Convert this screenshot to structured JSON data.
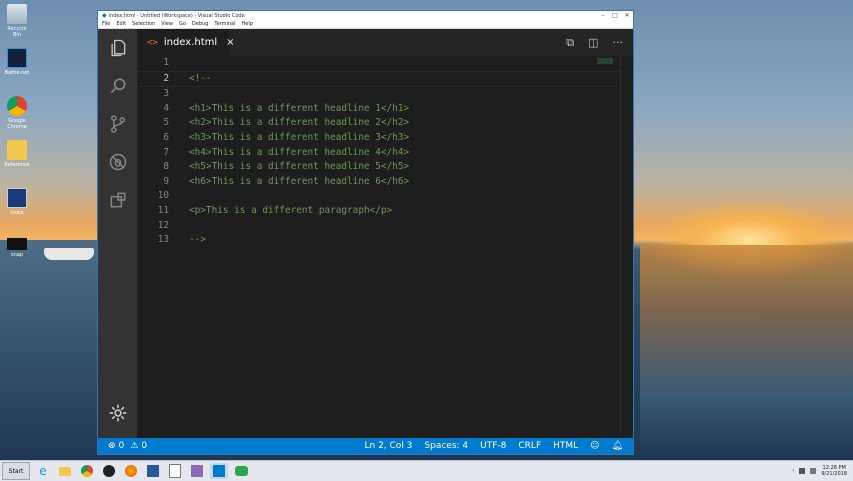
{
  "desktop": {
    "icons": [
      {
        "label": "Recycle Bin",
        "icon": "recycle-bin-icon"
      },
      {
        "label": "Battle.net",
        "icon": "battlenet-icon"
      },
      {
        "label": "Google Chrome",
        "icon": "chrome-icon"
      },
      {
        "label": "Reference",
        "icon": "folder-icon"
      },
      {
        "label": "index",
        "icon": "file-icon"
      },
      {
        "label": "snap",
        "icon": "monitor-icon"
      }
    ]
  },
  "window": {
    "title": "index.html - Untitled (Workspace) - Visual Studio Code",
    "menu": [
      "File",
      "Edit",
      "Selection",
      "View",
      "Go",
      "Debug",
      "Terminal",
      "Help"
    ]
  },
  "tab": {
    "label": "index.html",
    "close": "×"
  },
  "editor": {
    "lines": [
      {
        "num": "1",
        "text": ""
      },
      {
        "num": "2",
        "text": "<!--"
      },
      {
        "num": "3",
        "text": ""
      },
      {
        "num": "4",
        "text": "<h1>This is a different headline 1</h1>"
      },
      {
        "num": "5",
        "text": "<h2>This is a different headline 2</h2>"
      },
      {
        "num": "6",
        "text": "<h3>This is a different headline 3</h3>"
      },
      {
        "num": "7",
        "text": "<h4>This is a different headline 4</h4>"
      },
      {
        "num": "8",
        "text": "<h5>This is a different headline 5</h5>"
      },
      {
        "num": "9",
        "text": "<h6>This is a different headline 6</h6>"
      },
      {
        "num": "10",
        "text": ""
      },
      {
        "num": "11",
        "text": "<p>This is a different paragraph</p>"
      },
      {
        "num": "12",
        "text": ""
      },
      {
        "num": "13",
        "text": "-->"
      }
    ]
  },
  "status": {
    "errors": "0",
    "warnings": "0",
    "position": "Ln 2, Col 3",
    "spaces": "Spaces: 4",
    "encoding": "UTF-8",
    "eol": "CRLF",
    "language": "HTML"
  },
  "taskbar": {
    "start": "Start",
    "time": "12:28 PM",
    "date": "9/21/2018"
  },
  "colors": {
    "accent": "#007acc",
    "comment": "#6a9955",
    "tab_icon": "#e37933"
  }
}
